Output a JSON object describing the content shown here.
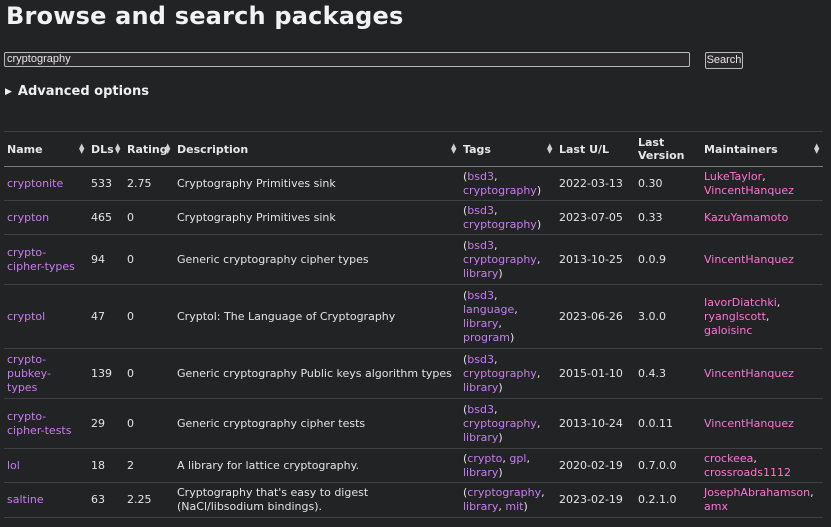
{
  "page": {
    "title": "Browse and search packages"
  },
  "search": {
    "value": "cryptography",
    "button_label": "Search"
  },
  "advanced": {
    "label": "Advanced options",
    "icon": "triangle-right-icon"
  },
  "columns": [
    "Name",
    "DLs",
    "Rating",
    "Description",
    "Tags",
    "Last U/L",
    "Last Version",
    "Maintainers"
  ],
  "sort_icon": "sort-updown-icon",
  "rows": [
    {
      "name": "cryptonite",
      "dls": "533",
      "rating": "2.75",
      "description": "Cryptography Primitives sink",
      "tags": [
        "bsd3",
        "cryptography"
      ],
      "last_ul": "2022-03-13",
      "version": "0.30",
      "maintainers": [
        "LukeTaylor",
        "VincentHanquez"
      ]
    },
    {
      "name": "crypton",
      "dls": "465",
      "rating": "0",
      "description": "Cryptography Primitives sink",
      "tags": [
        "bsd3",
        "cryptography"
      ],
      "last_ul": "2023-07-05",
      "version": "0.33",
      "maintainers": [
        "KazuYamamoto"
      ]
    },
    {
      "name": "crypto-cipher-types",
      "dls": "94",
      "rating": "0",
      "description": "Generic cryptography cipher types",
      "tags": [
        "bsd3",
        "cryptography",
        "library"
      ],
      "last_ul": "2013-10-25",
      "version": "0.0.9",
      "maintainers": [
        "VincentHanquez"
      ]
    },
    {
      "name": "cryptol",
      "dls": "47",
      "rating": "0",
      "description": "Cryptol: The Language of Cryptography",
      "tags": [
        "bsd3",
        "language",
        "library",
        "program"
      ],
      "last_ul": "2023-06-26",
      "version": "3.0.0",
      "maintainers": [
        "IavorDiatchki",
        "ryanglscott",
        "galoisinc"
      ]
    },
    {
      "name": "crypto-pubkey-types",
      "dls": "139",
      "rating": "0",
      "description": "Generic cryptography Public keys algorithm types",
      "tags": [
        "bsd3",
        "cryptography",
        "library"
      ],
      "last_ul": "2015-01-10",
      "version": "0.4.3",
      "maintainers": [
        "VincentHanquez"
      ]
    },
    {
      "name": "crypto-cipher-tests",
      "dls": "29",
      "rating": "0",
      "description": "Generic cryptography cipher tests",
      "tags": [
        "bsd3",
        "cryptography",
        "library"
      ],
      "last_ul": "2013-10-24",
      "version": "0.0.11",
      "maintainers": [
        "VincentHanquez"
      ]
    },
    {
      "name": "lol",
      "dls": "18",
      "rating": "2",
      "description": "A library for lattice cryptography.",
      "tags": [
        "crypto",
        "gpl",
        "library"
      ],
      "last_ul": "2020-02-19",
      "version": "0.7.0.0",
      "maintainers": [
        "crockeea",
        "crossroads1112"
      ]
    },
    {
      "name": "saltine",
      "dls": "63",
      "rating": "2.25",
      "description": "Cryptography that's easy to digest (NaCl/libsodium bindings).",
      "tags": [
        "cryptography",
        "library",
        "mit"
      ],
      "last_ul": "2023-02-19",
      "version": "0.2.1.0",
      "maintainers": [
        "JosephAbrahamson",
        "amx"
      ]
    }
  ]
}
